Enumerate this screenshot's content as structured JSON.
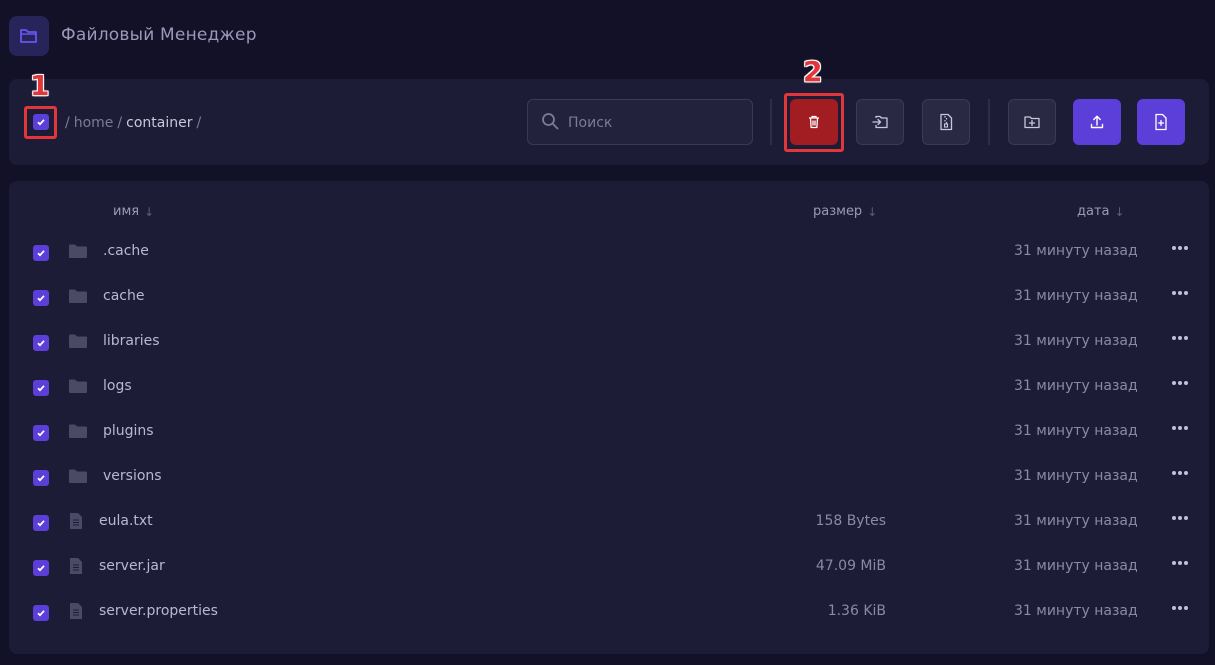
{
  "app": {
    "title": "Файловый Менеджер",
    "logo_icon": "folder-icon",
    "accent": "#5b3fd8",
    "danger": "#a11d22"
  },
  "annotations": [
    {
      "label": "1"
    },
    {
      "label": "2"
    }
  ],
  "toolbar": {
    "select_all_checked": true,
    "breadcrumb": [
      "home",
      "container"
    ],
    "search_placeholder": "Поиск",
    "buttons": [
      {
        "icon": "trash-icon",
        "style": "danger"
      },
      {
        "icon": "move-into-folder-icon",
        "style": "default"
      },
      {
        "icon": "archive-file-icon",
        "style": "default"
      },
      {
        "icon": "new-folder-icon",
        "style": "default"
      },
      {
        "icon": "upload-icon",
        "style": "primary"
      },
      {
        "icon": "new-file-icon",
        "style": "primary"
      }
    ]
  },
  "table": {
    "columns": {
      "name": "имя",
      "size": "размер",
      "date": "дата"
    },
    "rows": [
      {
        "type": "folder",
        "name": ".cache",
        "size": "",
        "date": "31 минуту назад",
        "checked": true
      },
      {
        "type": "folder",
        "name": "cache",
        "size": "",
        "date": "31 минуту назад",
        "checked": true
      },
      {
        "type": "folder",
        "name": "libraries",
        "size": "",
        "date": "31 минуту назад",
        "checked": true
      },
      {
        "type": "folder",
        "name": "logs",
        "size": "",
        "date": "31 минуту назад",
        "checked": true
      },
      {
        "type": "folder",
        "name": "plugins",
        "size": "",
        "date": "31 минуту назад",
        "checked": true
      },
      {
        "type": "folder",
        "name": "versions",
        "size": "",
        "date": "31 минуту назад",
        "checked": true
      },
      {
        "type": "file",
        "name": "eula.txt",
        "size": "158 Bytes",
        "date": "31 минуту назад",
        "checked": true
      },
      {
        "type": "file",
        "name": "server.jar",
        "size": "47.09 MiB",
        "date": "31 минуту назад",
        "checked": true
      },
      {
        "type": "file",
        "name": "server.properties",
        "size": "1.36 KiB",
        "date": "31 минуту назад",
        "checked": true
      }
    ]
  }
}
